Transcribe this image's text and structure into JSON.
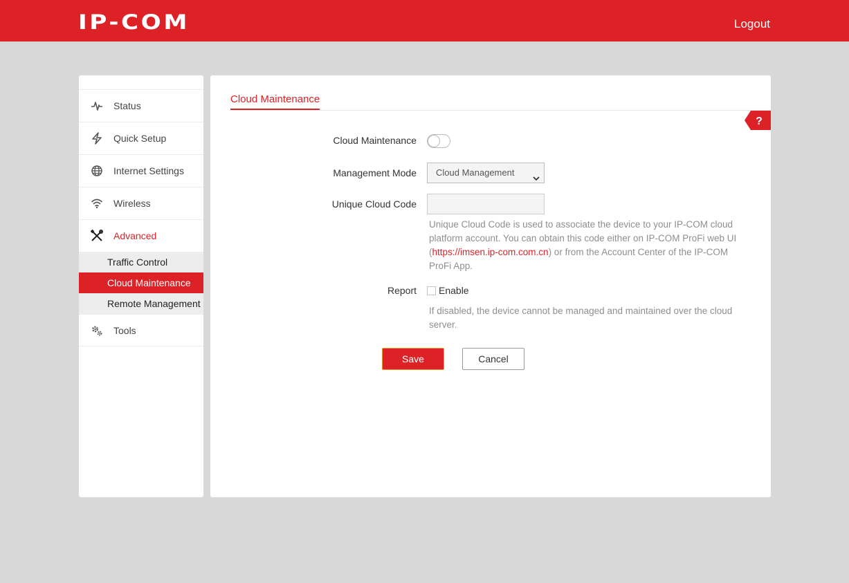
{
  "header": {
    "logo_text": "IP-COM",
    "logout_label": "Logout"
  },
  "sidebar": {
    "items": [
      {
        "label": "Status",
        "icon": "pulse-icon"
      },
      {
        "label": "Quick Setup",
        "icon": "lightning-icon"
      },
      {
        "label": "Internet Settings",
        "icon": "globe-icon"
      },
      {
        "label": "Wireless",
        "icon": "wifi-icon"
      },
      {
        "label": "Advanced",
        "icon": "tools-icon",
        "active": true
      },
      {
        "label": "Tools",
        "icon": "gears-icon"
      }
    ],
    "advanced_sub": [
      {
        "label": "Traffic Control"
      },
      {
        "label": "Cloud Maintenance",
        "current": true
      },
      {
        "label": "Remote Management"
      }
    ]
  },
  "main": {
    "tab_title": "Cloud Maintenance",
    "help_label": "?",
    "form": {
      "cloud_maintenance_label": "Cloud Maintenance",
      "cloud_maintenance_enabled": false,
      "management_mode_label": "Management Mode",
      "management_mode_value": "Cloud Management",
      "unique_code_label": "Unique Cloud Code",
      "unique_code_value": "",
      "unique_code_note_before": "Unique Cloud Code is used to associate the device to your IP-COM cloud platform account. You can obtain this code either on IP-COM ProFi web UI (",
      "unique_code_note_link": "https://imsen.ip-com.com.cn",
      "unique_code_note_after": ") or from the Account Center of the IP-COM ProFi App.",
      "report_label": "Report",
      "report_enable_label": "Enable",
      "report_enabled": false,
      "report_note": "If disabled, the device cannot be managed and maintained over the cloud server."
    },
    "buttons": {
      "save": "Save",
      "cancel": "Cancel"
    }
  },
  "colors": {
    "brand_red": "#dc2127",
    "background": "#d8d8d8",
    "note_gray": "#8e8e8e"
  }
}
